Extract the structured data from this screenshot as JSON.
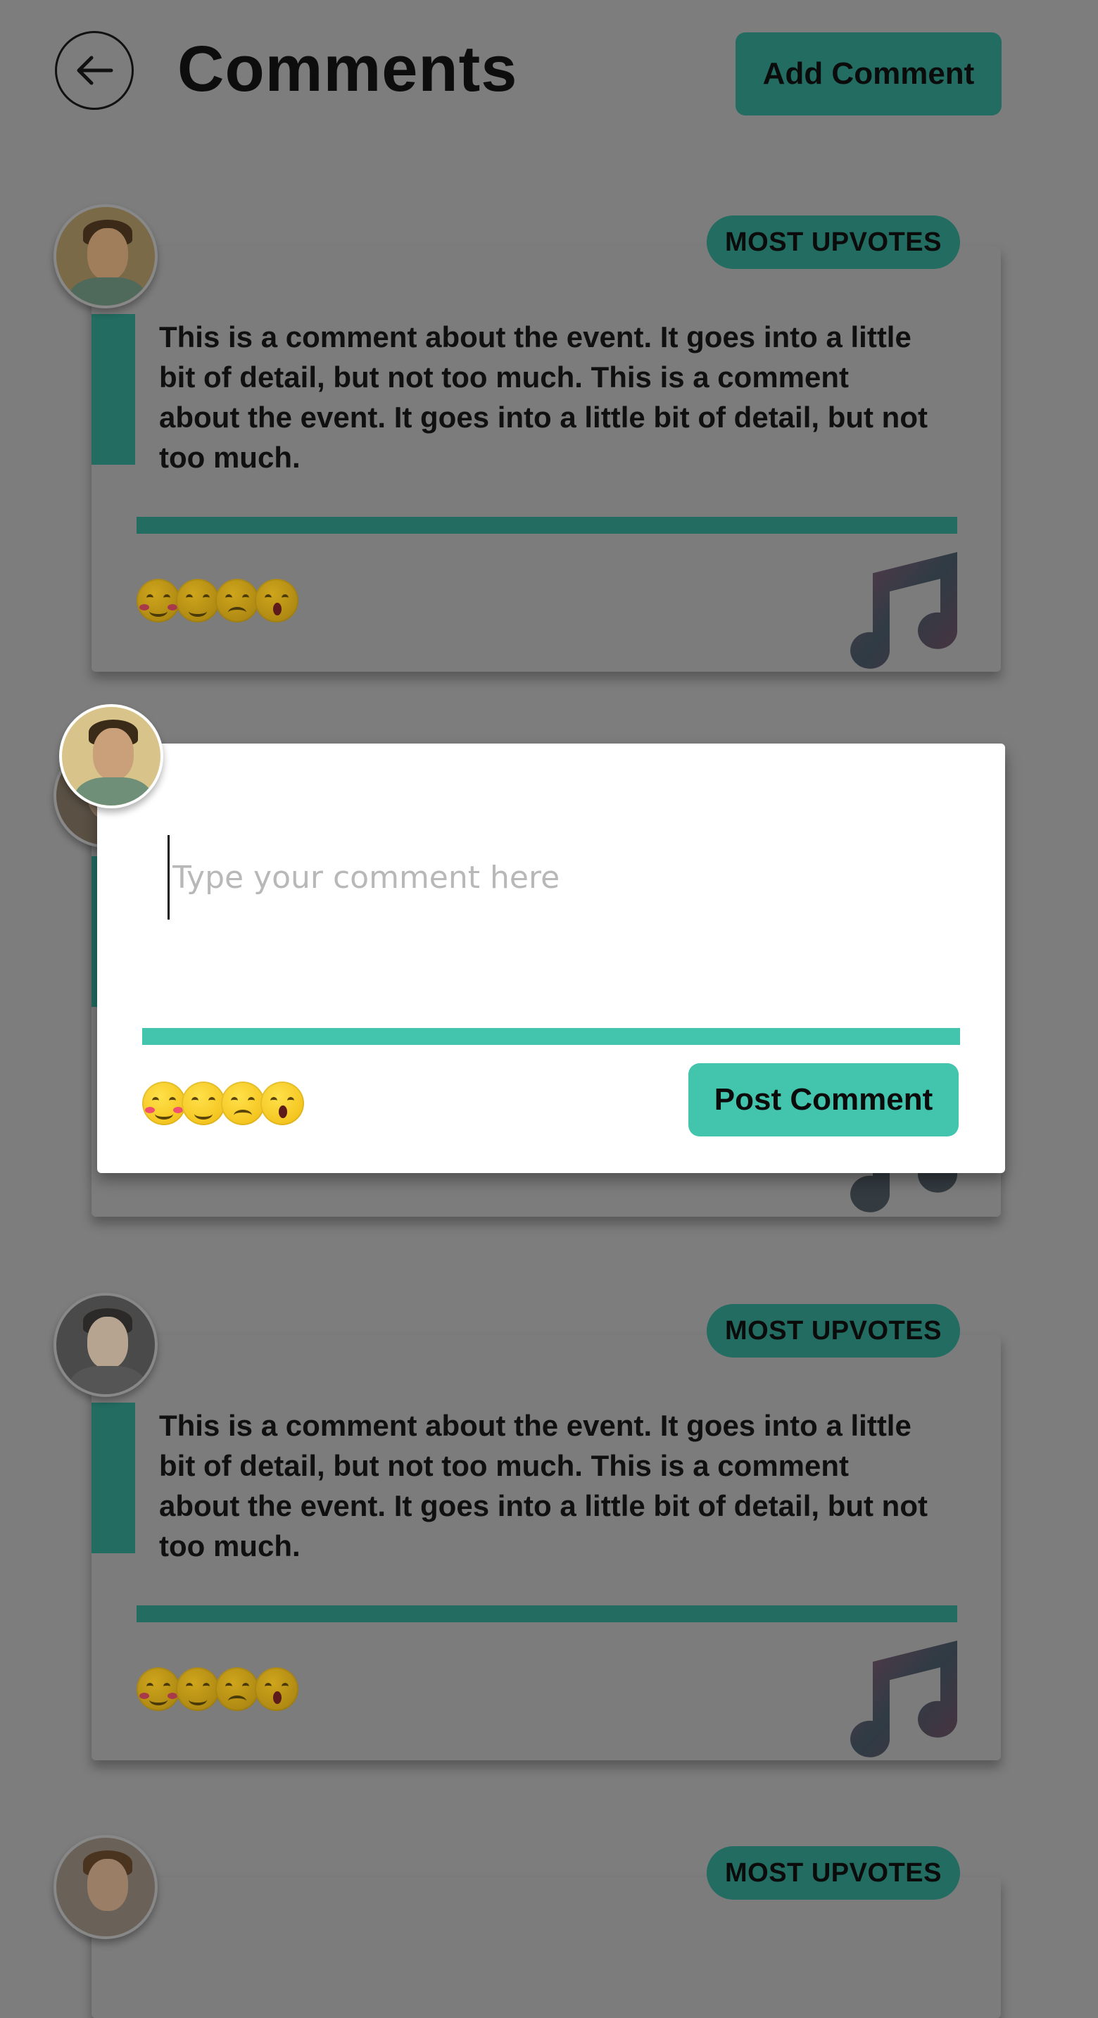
{
  "header": {
    "title": "Comments",
    "add_comment_label": "Add Comment"
  },
  "badge_label": "MOST UPVOTES",
  "comments": [
    {
      "text": "This is a comment about the event. It goes into a little bit of detail, but not too much. This is a comment about the event. It goes into a little bit of detail, but not too much."
    },
    {
      "text": ""
    },
    {
      "text": "This is a comment about the event. It goes into a little bit of detail, but not too much. This is a comment about the event. It goes into a little bit of detail, but not too much."
    },
    {
      "text": ""
    }
  ],
  "modal": {
    "placeholder": "Type your comment here",
    "post_label": "Post Comment"
  },
  "colors": {
    "overlay_background": "#7d7d7d",
    "accent_dimmed": "#226c61",
    "accent": "#43c5ad",
    "modal_background": "#ffffff"
  },
  "icons": {
    "back": "back-arrow-icon",
    "music": "music-note-icon",
    "reactions": [
      "blushing-smile-emoji-icon",
      "smile-emoji-icon",
      "unamused-emoji-icon",
      "shocked-emoji-icon"
    ]
  }
}
